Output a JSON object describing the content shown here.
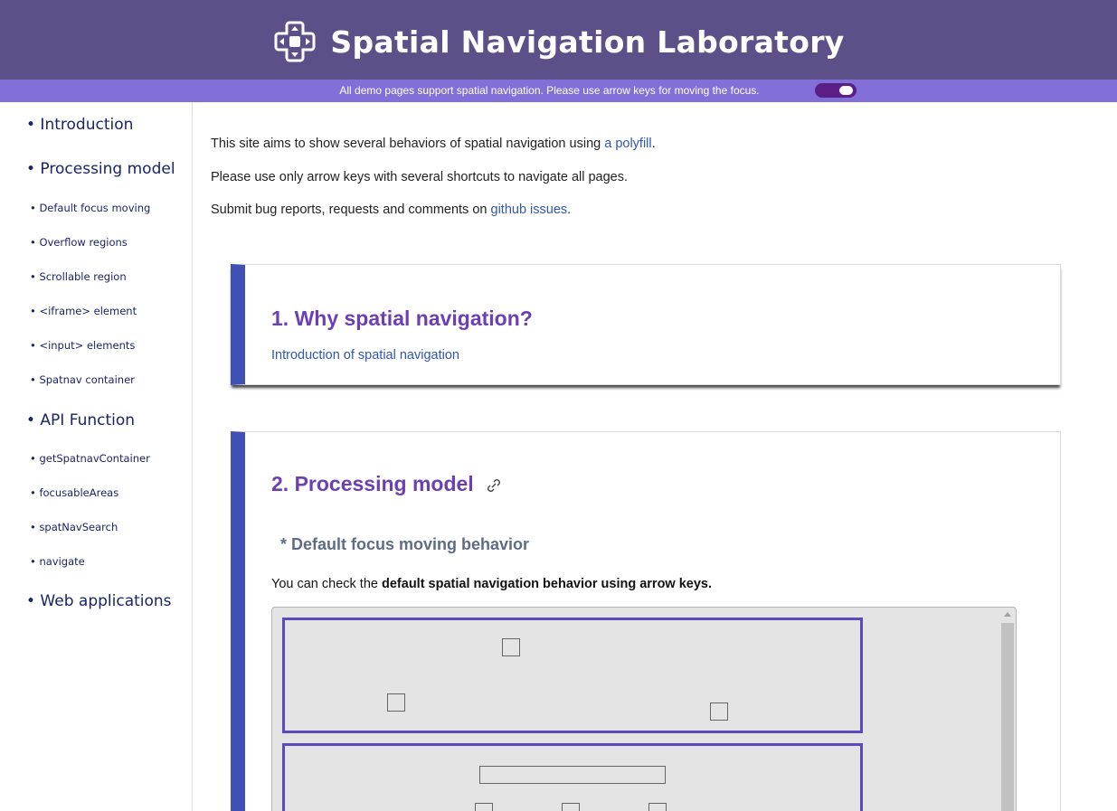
{
  "header": {
    "title": "Spatial Navigation Laboratory",
    "logo_icon": "dpad-icon",
    "bg_color": "#5d5089"
  },
  "subbar": {
    "text": "All demo pages support spatial navigation. Please use arrow keys for moving the focus.",
    "toggle_on": true,
    "bg_color": "#8270d8"
  },
  "sidebar": {
    "items": [
      {
        "label": "• Introduction",
        "level": 1
      },
      {
        "label": "• Processing model",
        "level": 1
      },
      {
        "label": "• Default focus moving",
        "level": 2
      },
      {
        "label": "• Overflow regions",
        "level": 2
      },
      {
        "label": "• Scrollable region",
        "level": 2
      },
      {
        "label": "• <iframe> element",
        "level": 2
      },
      {
        "label": "• <input> elements",
        "level": 2
      },
      {
        "label": "• Spatnav container",
        "level": 2
      },
      {
        "label": "• API Function",
        "level": 1
      },
      {
        "label": "• getSpatnavContainer",
        "level": 2
      },
      {
        "label": "• focusableAreas",
        "level": 2
      },
      {
        "label": "• spatNavSearch",
        "level": 2
      },
      {
        "label": "• navigate",
        "level": 2
      },
      {
        "label": "• Web applications",
        "level": 1
      }
    ]
  },
  "intro": {
    "line1_text": "This site aims to show several behaviors of spatial navigation using ",
    "line1_link": "a polyfill",
    "line1_end": ".",
    "line2": "Please use only arrow keys with several shortcuts to navigate all pages.",
    "line3_text": "Submit bug reports, requests and comments on ",
    "line3_link": "github issues",
    "line3_end": "."
  },
  "card1": {
    "title": "1. Why spatial navigation?",
    "link": "Introduction of spatial navigation"
  },
  "card2": {
    "title": "2. Processing model",
    "title_icon": "link-chain-icon",
    "subheading": "* Default focus moving behavior",
    "desc_text": "You can check the ",
    "desc_bold": "default spatial navigation behavior using arrow keys."
  },
  "colors": {
    "accent": "#3f51b5",
    "title": "#6c3fb3",
    "region_border": "#5c49c0",
    "link": "#2e57b9"
  }
}
